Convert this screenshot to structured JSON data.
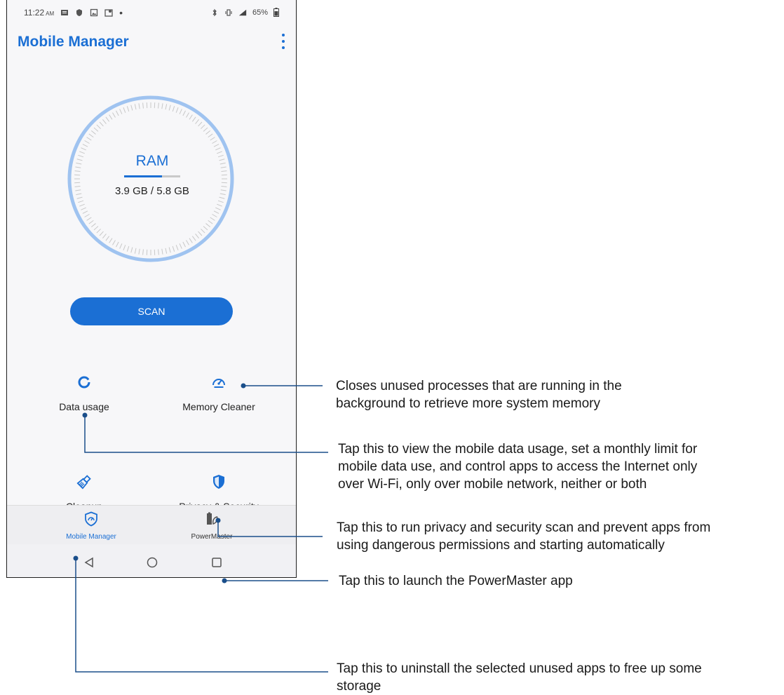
{
  "status_bar": {
    "time": "11:22",
    "ampm": "AM",
    "battery": "65%"
  },
  "app": {
    "title": "Mobile Manager"
  },
  "ram": {
    "label": "RAM",
    "value": "3.9 GB / 5.8 GB",
    "fraction": 0.67
  },
  "scan_label": "SCAN",
  "features": {
    "data_usage": {
      "label": "Data usage",
      "icon": "donut-icon"
    },
    "memory_cleaner": {
      "label": "Memory Cleaner",
      "icon": "speedometer-icon"
    },
    "cleanup": {
      "label": "Cleanup",
      "icon": "broom-icon"
    },
    "privacy_security": {
      "label": "Privacy & Security",
      "icon": "shield-icon"
    }
  },
  "bottom_nav": {
    "mobile_manager": {
      "label": "Mobile Manager",
      "icon": "shield-gauge-icon",
      "active": true
    },
    "powermaster": {
      "label": "PowerMaster",
      "icon": "battery-leaf-icon",
      "active": false
    }
  },
  "annotations": {
    "memory_cleaner": [
      "Closes unused processes that are running in the",
      "background to retrieve more system memory"
    ],
    "data_usage": [
      "Tap this to view the mobile data usage, set a monthly limit for",
      "mobile data use, and control apps to access the Internet only",
      "over Wi-Fi, only over mobile network, neither or both"
    ],
    "privacy_security": [
      "Tap this to run privacy and security scan and prevent apps from",
      "using dangerous permissions and starting automatically"
    ],
    "powermaster": [
      "Tap this to launch the PowerMaster app"
    ],
    "cleanup": [
      "Tap this to uninstall the selected unused apps to free up some",
      "storage"
    ]
  },
  "colors": {
    "accent": "#1b6fd4",
    "gauge_ring": "#9fc3f0",
    "ticks": "#c8c8c8",
    "callout_line": "#1a4e8a"
  }
}
